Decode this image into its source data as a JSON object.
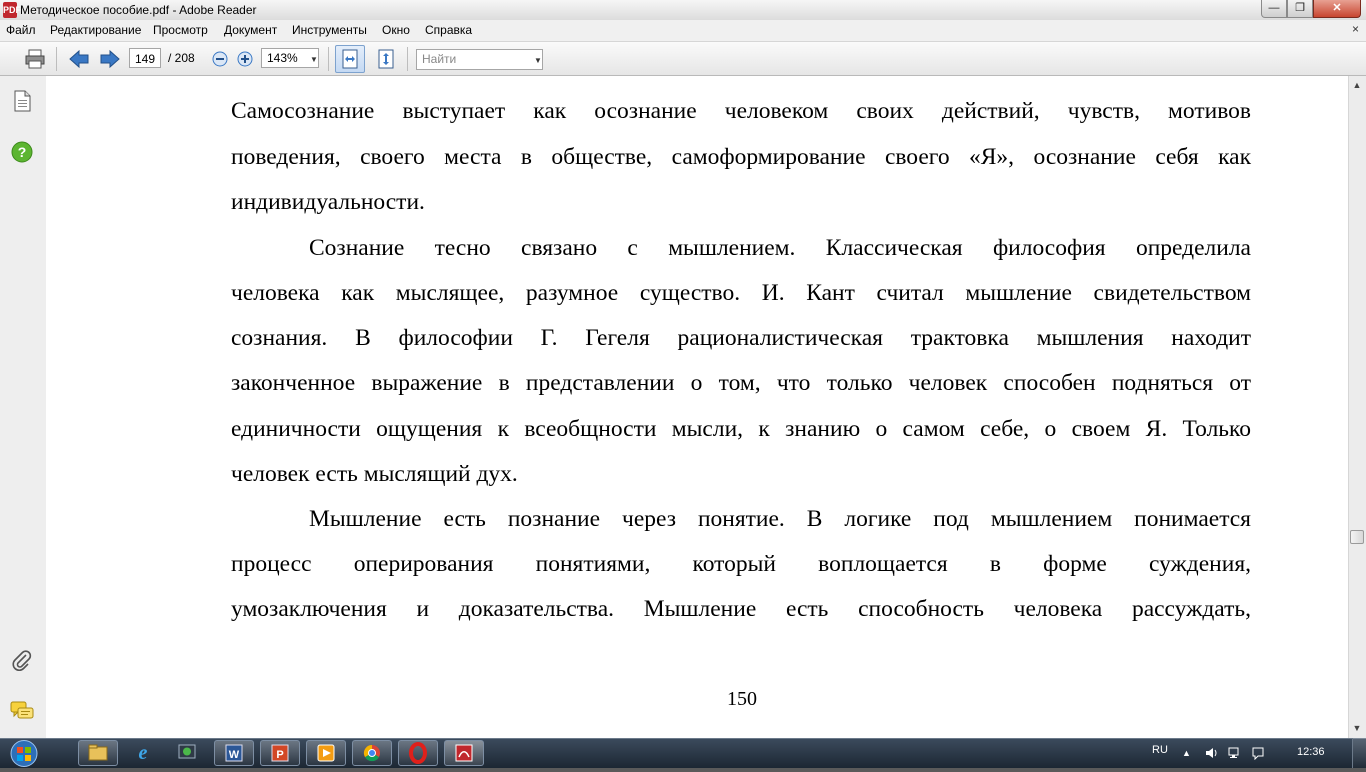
{
  "window": {
    "icon_label": "PDF",
    "title": "Методическое пособие.pdf - Adobe Reader",
    "minimize_glyph": "—",
    "maximize_glyph": "❐",
    "close_glyph": "✕"
  },
  "menu": {
    "items": [
      "Файл",
      "Редактирование",
      "Просмотр",
      "Документ",
      "Инструменты",
      "Окно",
      "Справка"
    ],
    "close_glyph": "×"
  },
  "toolbar": {
    "icons": [
      "print-icon",
      "previous-page-icon",
      "next-page-icon",
      "zoom-out-icon",
      "zoom-in-icon",
      "fit-width-icon",
      "fit-page-icon"
    ],
    "current_page": "149",
    "total_pages": "/ 208",
    "zoom": "143%",
    "find_placeholder": "Найти",
    "dropdown_glyph": "▼"
  },
  "left_panel": {
    "icons": [
      "pages-icon",
      "help-icon",
      "attachment-icon",
      "comments-icon"
    ]
  },
  "document": {
    "lines": [
      "Самосознание выступает как осознание человеком своих действий, чувств, мотивов",
      "поведения, своего места в обществе, самоформирование своего «Я», осознание себя как",
      "индивидуальности.",
      "Сознание тесно связано с мышлением. Классическая философия определила",
      "человека как мыслящее, разумное существо. И. Кант считал мышление свидетельством",
      "сознания. В философии Г. Гегеля рационалистическая трактовка мышления находит",
      "законченное выражение в представлении о том, что только человек способен подняться от",
      "единичности ощущения к всеобщности мысли, к знанию о самом себе, о своем Я. Только",
      "человек есть мыслящий дух.",
      "Мышление есть познание через понятие. В логике под мышлением понимается",
      "процесс оперирования понятиями, который воплощается в форме суждения,",
      "умозаключения и доказательства. Мышление есть способность человека рассуждать,"
    ],
    "page_number": "150"
  },
  "scrollbar": {
    "up_glyph": "▲",
    "down_glyph": "▼"
  },
  "taskbar": {
    "apps": [
      "explorer-icon",
      "internet-explorer-icon",
      "media-center-icon",
      "word-icon",
      "powerpoint-icon",
      "media-player-icon",
      "chrome-icon",
      "opera-icon",
      "adobe-reader-icon"
    ],
    "language": "RU",
    "clock": "12:36"
  },
  "colors": {
    "pdf_red": "#c0272d",
    "help_green": "#5cb531",
    "nav_blue": "#3a78c4",
    "taskbar": "#1c2733"
  }
}
